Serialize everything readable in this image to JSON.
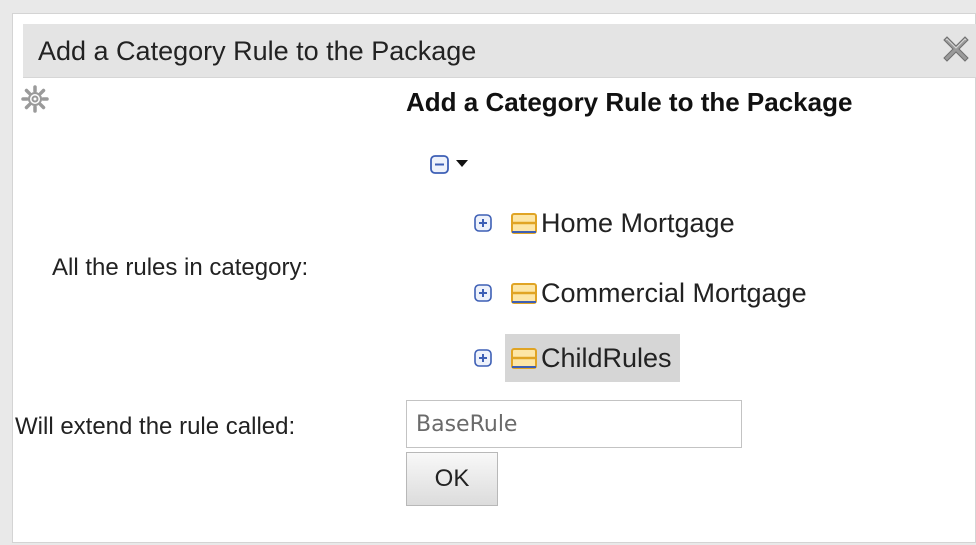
{
  "dialog": {
    "title": "Add a Category Rule to the Package",
    "close_icon": "close-icon",
    "settings_icon": "gear-icon",
    "heading": "Add a Category Rule to the Package"
  },
  "form": {
    "category_label": "All the rules in category:",
    "extend_label": "Will extend the rule called:",
    "extend_input_value": "BaseRule",
    "ok_label": "OK"
  },
  "tree": {
    "root": {
      "expanded": true,
      "expander_icon": "collapse-icon",
      "dropdown_icon": "caret-down-icon"
    },
    "items": [
      {
        "label": "Home Mortgage",
        "icon": "folder-icon",
        "expander_icon": "expand-icon",
        "selected": false
      },
      {
        "label": "Commercial Mortgage",
        "icon": "folder-icon",
        "expander_icon": "expand-icon",
        "selected": false
      },
      {
        "label": "ChildRules",
        "icon": "folder-icon",
        "expander_icon": "expand-icon",
        "selected": true
      }
    ]
  },
  "colors": {
    "accent": "#3d5fb5",
    "folder": "#e0a424",
    "selected_row": "#d6d6d6"
  }
}
